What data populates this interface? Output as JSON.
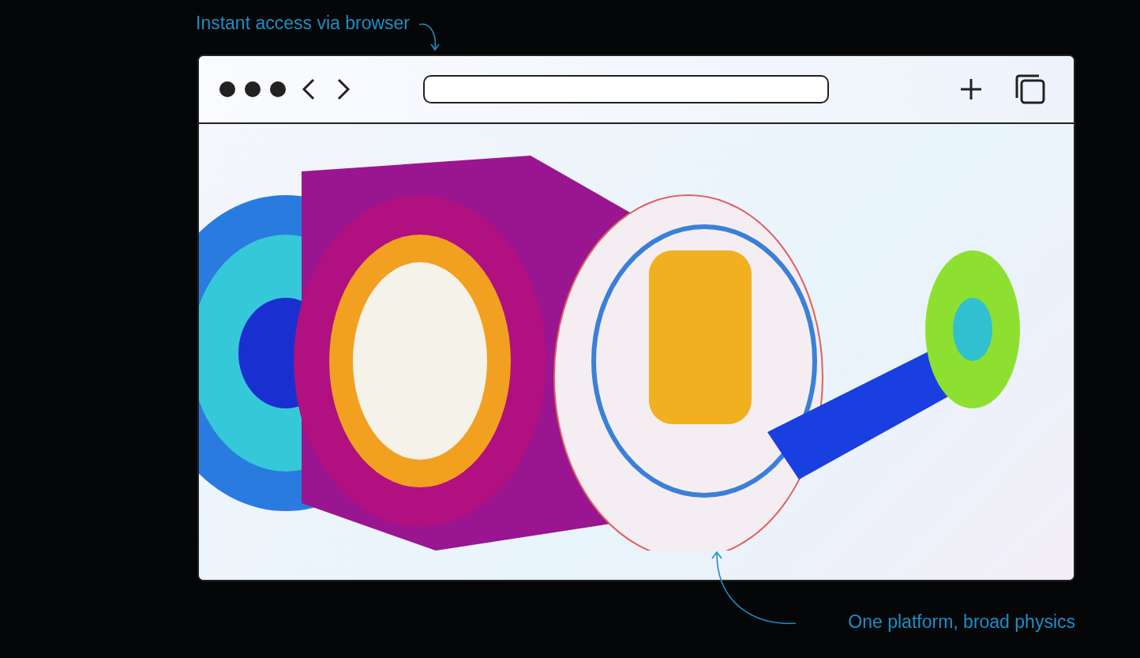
{
  "callouts": [
    {
      "text": "Instant access via browser"
    },
    {
      "text": "One platform, broad physics"
    }
  ]
}
